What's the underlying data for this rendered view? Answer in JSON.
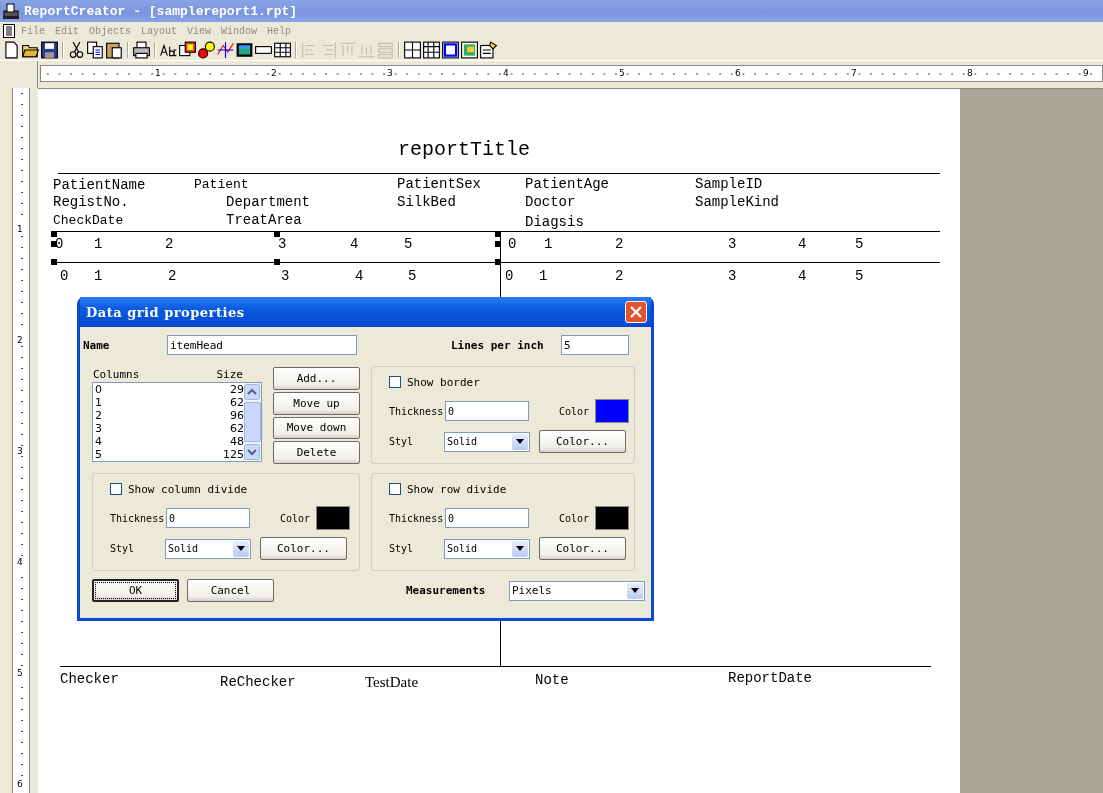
{
  "window": {
    "title": "ReportCreator - [samplereport1.rpt]"
  },
  "menu": [
    {
      "label": "File",
      "disabled": true
    },
    {
      "label": "Edit",
      "disabled": true
    },
    {
      "label": "Objects",
      "disabled": true
    },
    {
      "label": "Layout",
      "disabled": true
    },
    {
      "label": "View",
      "disabled": true
    },
    {
      "label": "Window",
      "disabled": true
    },
    {
      "label": "Help",
      "disabled": true
    }
  ],
  "toolbar": [
    {
      "kind": "button",
      "disabled": false
    },
    {
      "kind": "button",
      "disabled": false
    },
    {
      "kind": "button",
      "disabled": false
    },
    {
      "kind": "separator"
    },
    {
      "kind": "button",
      "disabled": false
    },
    {
      "kind": "button",
      "disabled": false
    },
    {
      "kind": "button",
      "disabled": false
    },
    {
      "kind": "separator"
    },
    {
      "kind": "button",
      "disabled": false
    },
    {
      "kind": "separator"
    },
    {
      "kind": "button",
      "disabled": false
    },
    {
      "kind": "button",
      "disabled": false
    },
    {
      "kind": "button",
      "disabled": false
    },
    {
      "kind": "button",
      "disabled": false
    },
    {
      "kind": "button",
      "disabled": false
    },
    {
      "kind": "button",
      "disabled": false
    },
    {
      "kind": "button",
      "disabled": false
    },
    {
      "kind": "separator"
    },
    {
      "kind": "button",
      "disabled": true
    },
    {
      "kind": "button",
      "disabled": true
    },
    {
      "kind": "button",
      "disabled": true
    },
    {
      "kind": "button",
      "disabled": true
    },
    {
      "kind": "button",
      "disabled": true
    },
    {
      "kind": "separator"
    },
    {
      "kind": "button",
      "disabled": false
    },
    {
      "kind": "button",
      "disabled": false
    },
    {
      "kind": "button",
      "disabled": false
    },
    {
      "kind": "button",
      "disabled": false
    },
    {
      "kind": "button",
      "disabled": false
    }
  ],
  "ruler": {
    "horizontal": [
      "1",
      "2",
      "3",
      "4",
      "5",
      "6",
      "7",
      "8",
      "9"
    ],
    "vertical": [
      "1",
      "2",
      "3",
      "4",
      "5",
      "6"
    ]
  },
  "report": {
    "title": "reportTitle",
    "header_fields": [
      "PatientName",
      "Patient",
      "PatientSex",
      "PatientAge",
      "SampleID",
      "RegistNo.",
      "Department",
      "SilkBed",
      "Doctor",
      "SampleKind",
      "CheckDate",
      "TreatArea",
      "Diagsis"
    ],
    "grid_rows": [
      [
        "0",
        "1",
        "2",
        "3",
        "4",
        "5",
        "0",
        "1",
        "2",
        "3",
        "4",
        "5"
      ],
      [
        "0",
        "1",
        "2",
        "3",
        "4",
        "5",
        "0",
        "1",
        "2",
        "3",
        "4",
        "5"
      ]
    ],
    "footer_fields": [
      "Checker",
      "ReChecker",
      "TestDate",
      "Note",
      "ReportDate"
    ]
  },
  "dialog": {
    "title": "Data grid properties",
    "name_label": "Name",
    "name_value": "itemHead",
    "lines_label": "Lines per inch",
    "lines_value": "5",
    "columns_label": "Columns",
    "size_label": "Size",
    "columns": [
      {
        "column": "0",
        "size": "29"
      },
      {
        "column": "1",
        "size": "62"
      },
      {
        "column": "2",
        "size": "96"
      },
      {
        "column": "3",
        "size": "62"
      },
      {
        "column": "4",
        "size": "48"
      },
      {
        "column": "5",
        "size": "125"
      }
    ],
    "buttons": [
      "Add...",
      "Move up",
      "Move down",
      "Delete"
    ],
    "groups": [
      {
        "checkbox": "Show border",
        "checked": false,
        "thickness_label": "Thickness",
        "thickness": "0",
        "color_label": "Color",
        "color": "#0000ff",
        "style_label": "Styl",
        "style": "Solid",
        "color_button": "Color..."
      },
      {
        "checkbox": "Show column divide",
        "checked": false,
        "thickness_label": "Thickness",
        "thickness": "0",
        "color_label": "Color",
        "color": "#000000",
        "style_label": "Styl",
        "style": "Solid",
        "color_button": "Color..."
      },
      {
        "checkbox": "Show row divide",
        "checked": false,
        "thickness_label": "Thickness",
        "thickness": "0",
        "color_label": "Color",
        "color": "#000000",
        "style_label": "Styl",
        "style": "Solid",
        "color_button": "Color..."
      }
    ],
    "ok": "OK",
    "cancel": "Cancel",
    "measurements_label": "Measurements",
    "measurements": "Pixels"
  }
}
